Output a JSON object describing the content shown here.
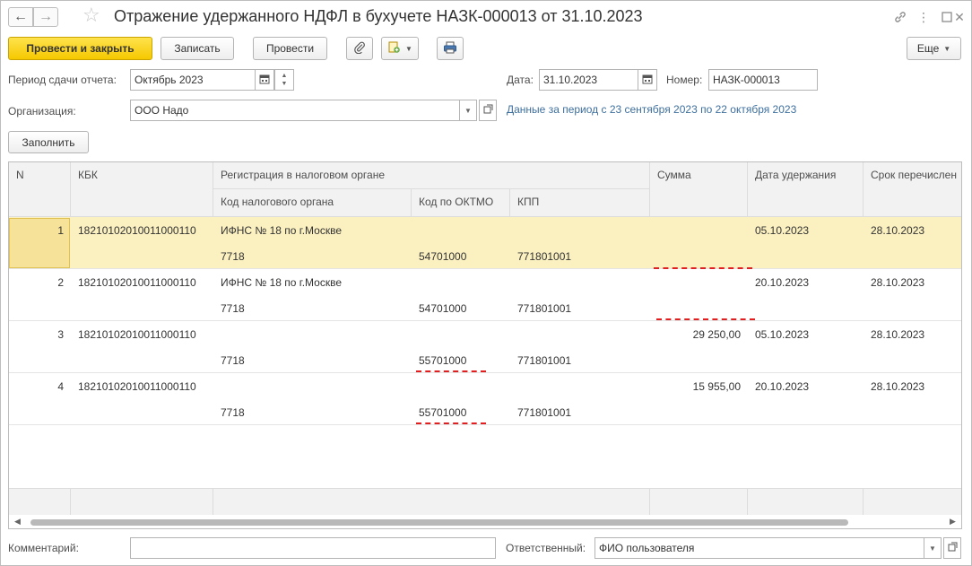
{
  "window": {
    "title": "Отражение удержанного НДФЛ в бухучете НАЗК-000013 от 31.10.2023",
    "back_icon": "arrow-left-icon",
    "forward_icon": "arrow-right-icon"
  },
  "toolbar": {
    "post_close": "Провести и закрыть",
    "save": "Записать",
    "post": "Провести",
    "more": "Еще"
  },
  "form": {
    "period_label": "Период сдачи отчета:",
    "period_value": "Октябрь 2023",
    "date_label": "Дата:",
    "date_value": "31.10.2023",
    "number_label": "Номер:",
    "number_value": "НАЗК-000013",
    "org_label": "Организация:",
    "org_value": "ООО Надо",
    "period_info": "Данные за период с 23 сентября 2023 по 22 октября 2023",
    "fill_button": "Заполнить",
    "comment_label": "Комментарий:",
    "comment_value": "",
    "responsible_label": "Ответственный:",
    "responsible_value": "ФИО пользователя"
  },
  "table": {
    "headers": {
      "n": "N",
      "kbk": "КБК",
      "registration": "Регистрация в налоговом органе",
      "tax_code": "Код налогового органа",
      "oktmo": "Код по ОКТМО",
      "kpp": "КПП",
      "sum": "Сумма",
      "date_withheld": "Дата удержания",
      "deadline": "Срок перечислен"
    },
    "rows": [
      {
        "n": "1",
        "kbk": "18210102010011000110",
        "tax_name": "ИФНС № 18 по г.Москве",
        "tax_code": "7718",
        "oktmo": "54701000",
        "kpp": "771801001",
        "sum": "",
        "date_withheld": "05.10.2023",
        "deadline": "28.10.2023"
      },
      {
        "n": "2",
        "kbk": "18210102010011000110",
        "tax_name": "ИФНС № 18 по г.Москве",
        "tax_code": "7718",
        "oktmo": "54701000",
        "kpp": "771801001",
        "sum": "",
        "date_withheld": "20.10.2023",
        "deadline": "28.10.2023"
      },
      {
        "n": "3",
        "kbk": "18210102010011000110",
        "tax_name": "",
        "tax_code": "7718",
        "oktmo": "55701000",
        "kpp": "771801001",
        "sum": "29 250,00",
        "date_withheld": "05.10.2023",
        "deadline": "28.10.2023"
      },
      {
        "n": "4",
        "kbk": "18210102010011000110",
        "tax_name": "",
        "tax_code": "7718",
        "oktmo": "55701000",
        "kpp": "771801001",
        "sum": "15 955,00",
        "date_withheld": "20.10.2023",
        "deadline": "28.10.2023"
      }
    ]
  },
  "colors": {
    "primary_button": "#f5c800",
    "selected_row": "#fbf0c0",
    "error_underline": "#e02020",
    "link": "#3d6f9e"
  }
}
